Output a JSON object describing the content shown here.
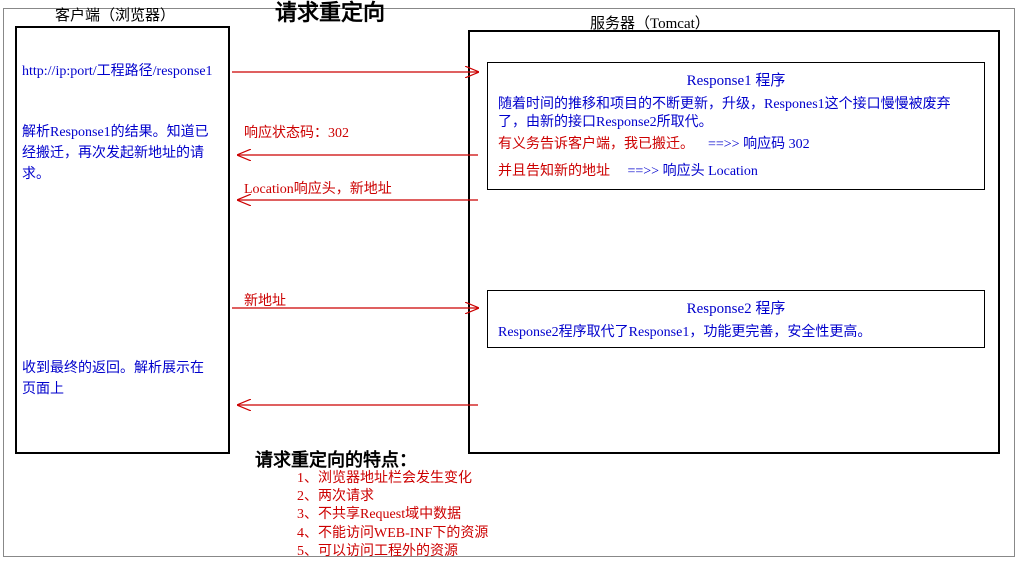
{
  "title_top": "请求重定向",
  "client_label": "客户端（浏览器）",
  "server_label": "服务器（Tomcat）",
  "url": "http://ip:port/工程路径/response1",
  "client_text1": "解析Response1的结果。知道已经搬迁，再次发起新地址的请求。",
  "client_text2": "收到最终的返回。解析展示在页面上",
  "response1": {
    "title": "Response1 程序",
    "line1": "随着时间的推移和项目的不断更新，升级，Respones1这个接口慢慢被废弃了，由新的接口Response2所取代。",
    "line2a": "有义务告诉客户端，我已搬迁。",
    "line2b": "==>> 响应码 302",
    "line3a": "并且告知新的地址",
    "line3b": "==>> 响应头 Location"
  },
  "response2": {
    "title": "Response2 程序",
    "line1": "Response2程序取代了Response1，功能更完善，安全性更高。"
  },
  "arrow_labels": {
    "status": "响应状态码：302",
    "location": "Location响应头，新地址",
    "new_addr": "新地址"
  },
  "features": {
    "title": "请求重定向的特点：",
    "items": [
      "1、浏览器地址栏会发生变化",
      "2、两次请求",
      "3、不共享Request域中数据",
      "4、不能访问WEB-INF下的资源",
      "5、可以访问工程外的资源"
    ]
  }
}
